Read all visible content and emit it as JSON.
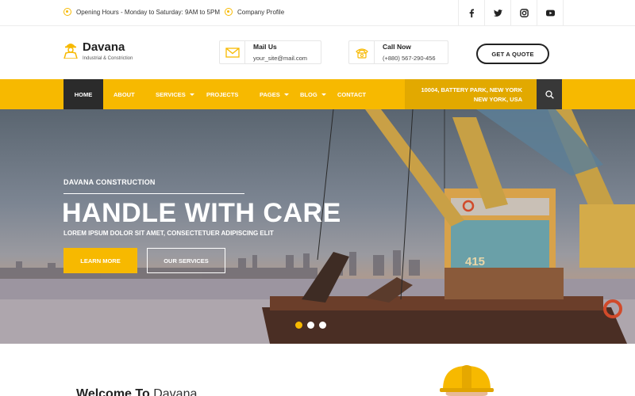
{
  "topbar": {
    "hours": "Opening Hours - Monday to Saturday: 9AM to 5PM",
    "profile": "Company Profile",
    "socials": [
      "facebook-icon",
      "twitter-icon",
      "instagram-icon",
      "youtube-icon"
    ]
  },
  "header": {
    "brand": "Davana",
    "tagline": "Industrial & Constriction",
    "mail": {
      "label": "Mail Us",
      "value": "your_site@mail.com"
    },
    "call": {
      "label": "Call Now",
      "value": "(+880) 567-290-456"
    },
    "quote_button": "GET A QUOTE"
  },
  "nav": {
    "items": [
      {
        "label": "HOME"
      },
      {
        "label": "ABOUT"
      },
      {
        "label": "SERVICES"
      },
      {
        "label": "PROJECTS"
      },
      {
        "label": "PAGES"
      },
      {
        "label": "BLOG"
      },
      {
        "label": "CONTACT"
      }
    ],
    "address_line1": "10004, BATTERY PARK, NEW YORK",
    "address_line2": "NEW YORK, USA"
  },
  "hero": {
    "subtitle": "DAVANA CONSTRUCTION",
    "title": "HANDLE WITH CARE",
    "description": "LOREM IPSUM DOLOR SIT AMET, CONSECTETUER ADIPISCING ELIT",
    "learn_more": "LEARN MORE",
    "our_services": "OUR SERVICES",
    "crane_number": "415"
  },
  "welcome": {
    "title": "Welcome To",
    "accent": "Davana"
  },
  "colors": {
    "accent": "#f7b900",
    "dark": "#2b2b2b"
  }
}
